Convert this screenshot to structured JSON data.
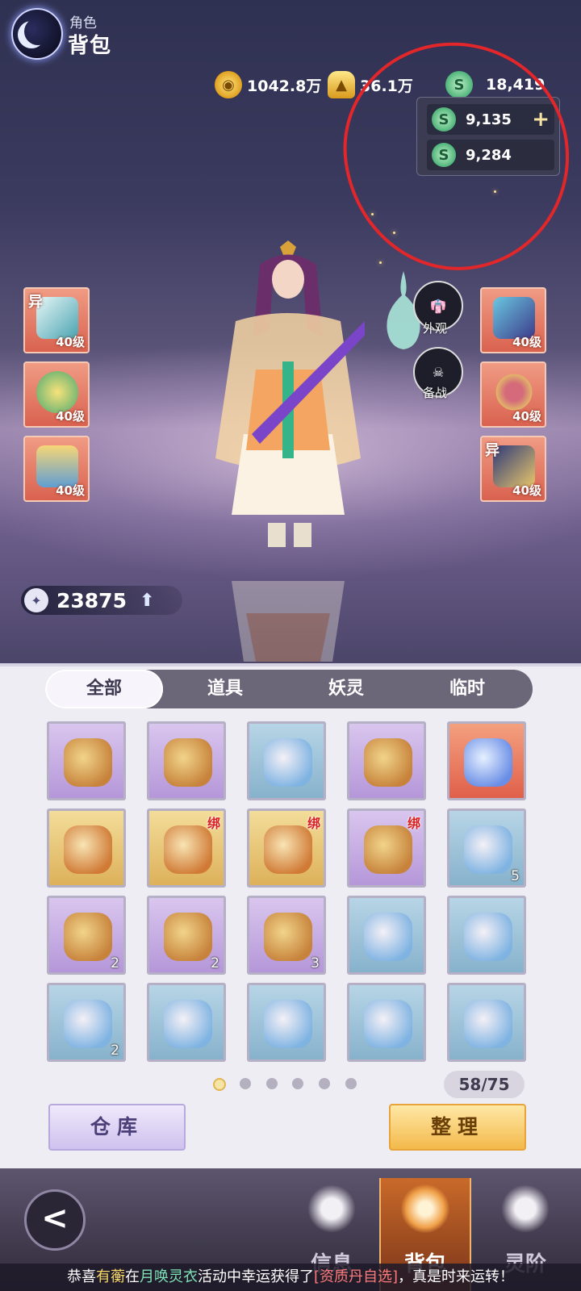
{
  "header": {
    "subtitle": "角色",
    "title": "背包"
  },
  "currencies": [
    {
      "icon": "copper-coin-icon",
      "value": "1042.8万"
    },
    {
      "icon": "gold-ingot-icon",
      "value": "36.1万"
    },
    {
      "icon": "jade-icon",
      "value": "18,419"
    }
  ],
  "jade_popup": {
    "rows": [
      {
        "icon": "jade-icon",
        "value": "9,135",
        "plus": "+"
      },
      {
        "icon": "bound-jade-icon",
        "value": "9,284"
      }
    ]
  },
  "equipment_left": [
    {
      "badge": "异",
      "level": "40级",
      "icon": "boots-icon"
    },
    {
      "badge": "",
      "level": "40级",
      "icon": "necklace-icon"
    },
    {
      "badge": "",
      "level": "40级",
      "icon": "helmet-icon"
    }
  ],
  "equipment_right": [
    {
      "badge": "",
      "level": "40级",
      "icon": "armor-icon"
    },
    {
      "badge": "",
      "level": "40级",
      "icon": "ring-icon"
    },
    {
      "badge": "异",
      "level": "40级",
      "icon": "bracer-icon"
    }
  ],
  "side_buttons": {
    "appearance": "外观",
    "battle": "备战"
  },
  "power": {
    "value": "23875"
  },
  "tabs": [
    "全部",
    "道具",
    "妖灵",
    "临时"
  ],
  "grid": [
    {
      "color": "purple",
      "icon": "pancake-icon",
      "count": "",
      "bound": ""
    },
    {
      "color": "purple",
      "icon": "flower-cake-icon",
      "count": "",
      "bound": ""
    },
    {
      "color": "blue",
      "icon": "meat-roll-icon",
      "count": "",
      "bound": ""
    },
    {
      "color": "purple",
      "icon": "gift-book-icon",
      "count": "",
      "bound": ""
    },
    {
      "color": "red",
      "icon": "crystal-flower-icon",
      "count": "",
      "bound": ""
    },
    {
      "color": "gold",
      "icon": "card-icon",
      "count": "",
      "bound": ""
    },
    {
      "color": "gold",
      "icon": "card-icon",
      "count": "",
      "bound": "绑"
    },
    {
      "color": "gold",
      "icon": "blue-orb-icon",
      "count": "",
      "bound": "绑"
    },
    {
      "color": "purple",
      "icon": "rose-icon",
      "count": "",
      "bound": "绑"
    },
    {
      "color": "blue",
      "icon": "green-orb-icon",
      "count": "5",
      "bound": ""
    },
    {
      "color": "purple",
      "icon": "gem-icon",
      "count": "2",
      "bound": ""
    },
    {
      "color": "purple",
      "icon": "pouch-icon",
      "count": "2",
      "bound": ""
    },
    {
      "color": "purple",
      "icon": "book-icon",
      "count": "3",
      "bound": ""
    },
    {
      "color": "blue",
      "icon": "bamboo-icon",
      "count": "",
      "bound": ""
    },
    {
      "color": "blue",
      "icon": "white-flower-icon",
      "count": "",
      "bound": ""
    },
    {
      "color": "blue",
      "icon": "yellow-flower-icon",
      "count": "2",
      "bound": ""
    },
    {
      "color": "blue",
      "icon": "wind-book-icon",
      "count": "",
      "bound": ""
    },
    {
      "color": "blue",
      "icon": "thunder-book-icon",
      "count": "",
      "bound": ""
    },
    {
      "color": "blue",
      "icon": "cloud-book-icon",
      "count": "",
      "bound": ""
    },
    {
      "color": "blue",
      "icon": "leaf-book-icon",
      "count": "",
      "bound": ""
    }
  ],
  "pagination": {
    "pages": 6,
    "current": 1
  },
  "capacity": "58/75",
  "buttons": {
    "storage": "仓库",
    "sort": "整理"
  },
  "nav": {
    "back": "<",
    "items": [
      "信息",
      "背包",
      "灵阶"
    ]
  },
  "ticker": {
    "prefix": "恭喜",
    "name": "有蘅",
    "mid1": "在",
    "event": "月唤灵衣",
    "mid2": "活动中幸运获得了",
    "item": "[资质丹自选]",
    "suffix": "，真是时来运转！"
  },
  "colors": {
    "accent": "#f3b94b",
    "annotation": "#e3262a"
  }
}
